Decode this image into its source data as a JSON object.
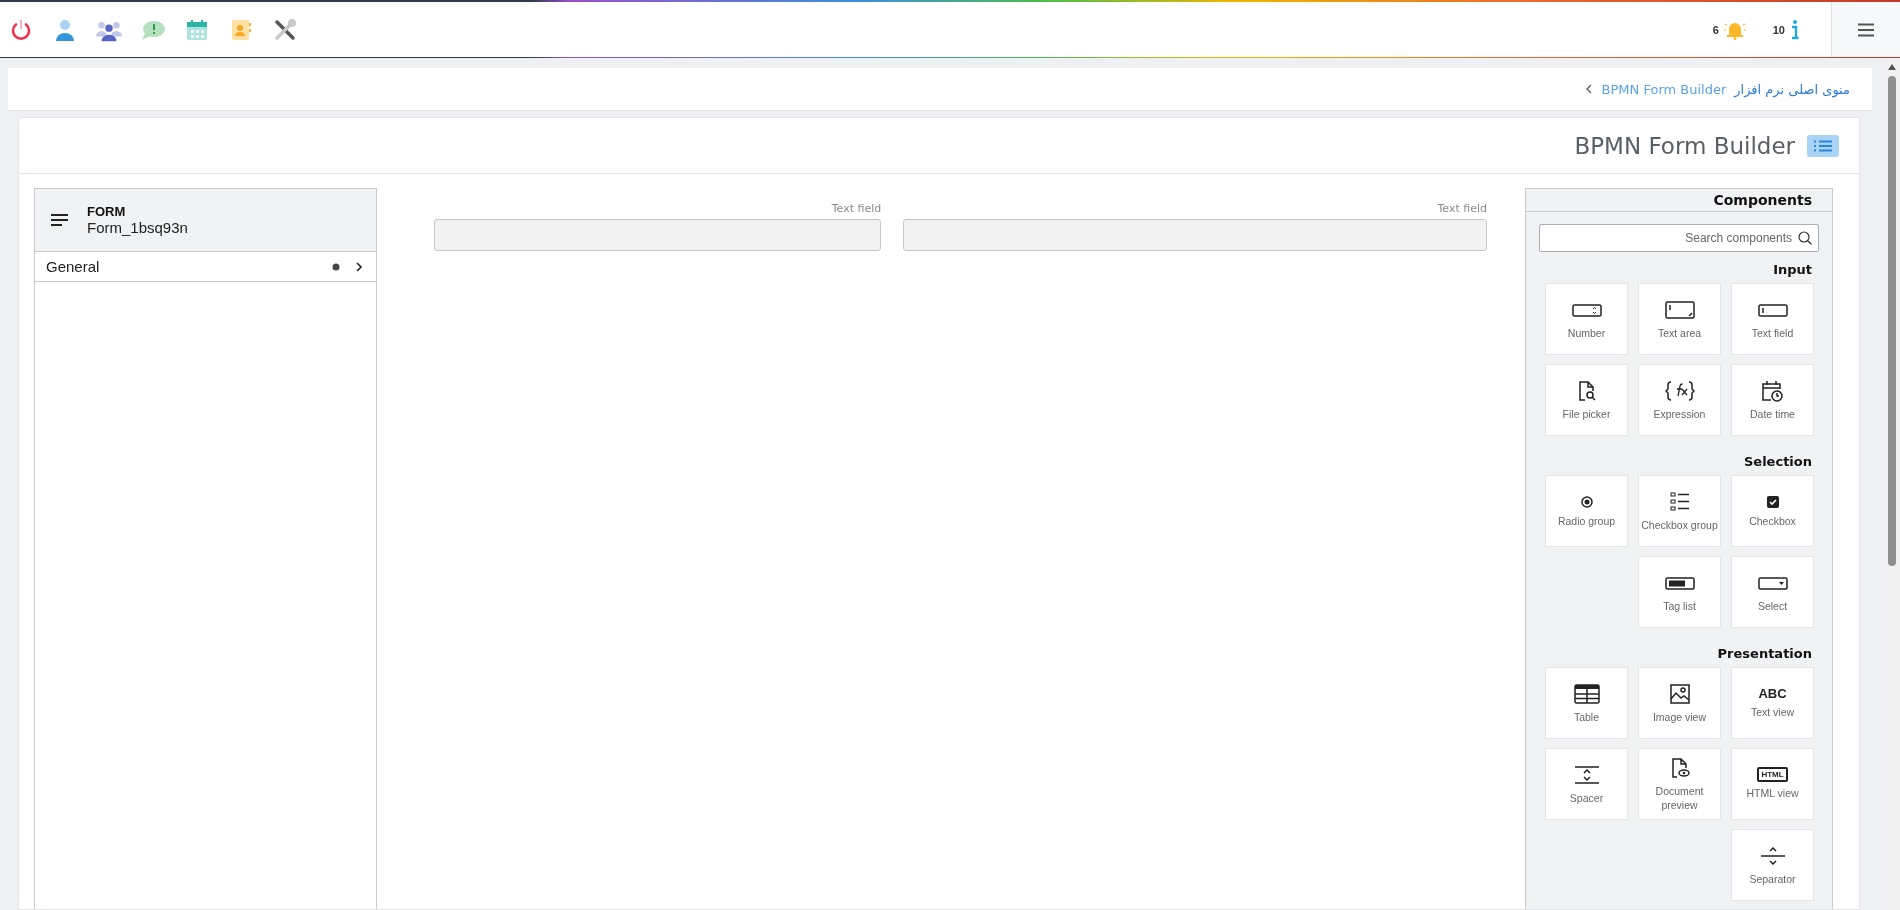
{
  "topbar": {
    "apps": [
      {
        "kind": "power"
      },
      {
        "kind": "user"
      },
      {
        "kind": "users"
      },
      {
        "kind": "chat"
      },
      {
        "kind": "calendar"
      },
      {
        "kind": "contacts"
      },
      {
        "kind": "tools"
      }
    ],
    "notifications": [
      {
        "kind": "bell",
        "count": "6"
      },
      {
        "kind": "info",
        "count": "10"
      }
    ]
  },
  "breadcrumb": [
    {
      "text": "BPMN Form Builder",
      "current": true
    },
    {
      "text": "منوی اصلی نرم افزار",
      "current": false
    }
  ],
  "page_title": "BPMN Form Builder",
  "properties_panel": {
    "type": "FORM",
    "name": "Form_1bsq93n",
    "groups": [
      {
        "label": "General",
        "expanded": false
      }
    ]
  },
  "form_fields": [
    {
      "label": "Text field"
    },
    {
      "label": "Text field"
    }
  ],
  "components_panel": {
    "title": "Components",
    "search_placeholder": "Search components",
    "sections": [
      {
        "title": "Input",
        "items": [
          {
            "kind": "number",
            "label": "Number"
          },
          {
            "kind": "textarea",
            "label": "Text area"
          },
          {
            "kind": "textfield",
            "label": "Text field"
          },
          {
            "kind": "filepicker",
            "label": "File picker"
          },
          {
            "kind": "expression",
            "label": "Expression"
          },
          {
            "kind": "datetime",
            "label": "Date time"
          }
        ]
      },
      {
        "title": "Selection",
        "items": [
          {
            "kind": "radio",
            "label": "Radio group"
          },
          {
            "kind": "checklist",
            "label": "Checkbox group"
          },
          {
            "kind": "checkbox",
            "label": "Checkbox"
          },
          {
            "kind": "taglist",
            "label": "Tag list"
          },
          {
            "kind": "select",
            "label": "Select"
          }
        ]
      },
      {
        "title": "Presentation",
        "items": [
          {
            "kind": "table",
            "label": "Table"
          },
          {
            "kind": "image",
            "label": "Image view"
          },
          {
            "kind": "text",
            "label": "Text view",
            "icon_text": "ABC"
          },
          {
            "kind": "spacer",
            "label": "Spacer"
          },
          {
            "kind": "document",
            "label": "Document preview"
          },
          {
            "kind": "html",
            "label": "HTML view",
            "icon_text": "HTML"
          },
          {
            "kind": "separator",
            "label": "Separator"
          }
        ]
      }
    ]
  }
}
